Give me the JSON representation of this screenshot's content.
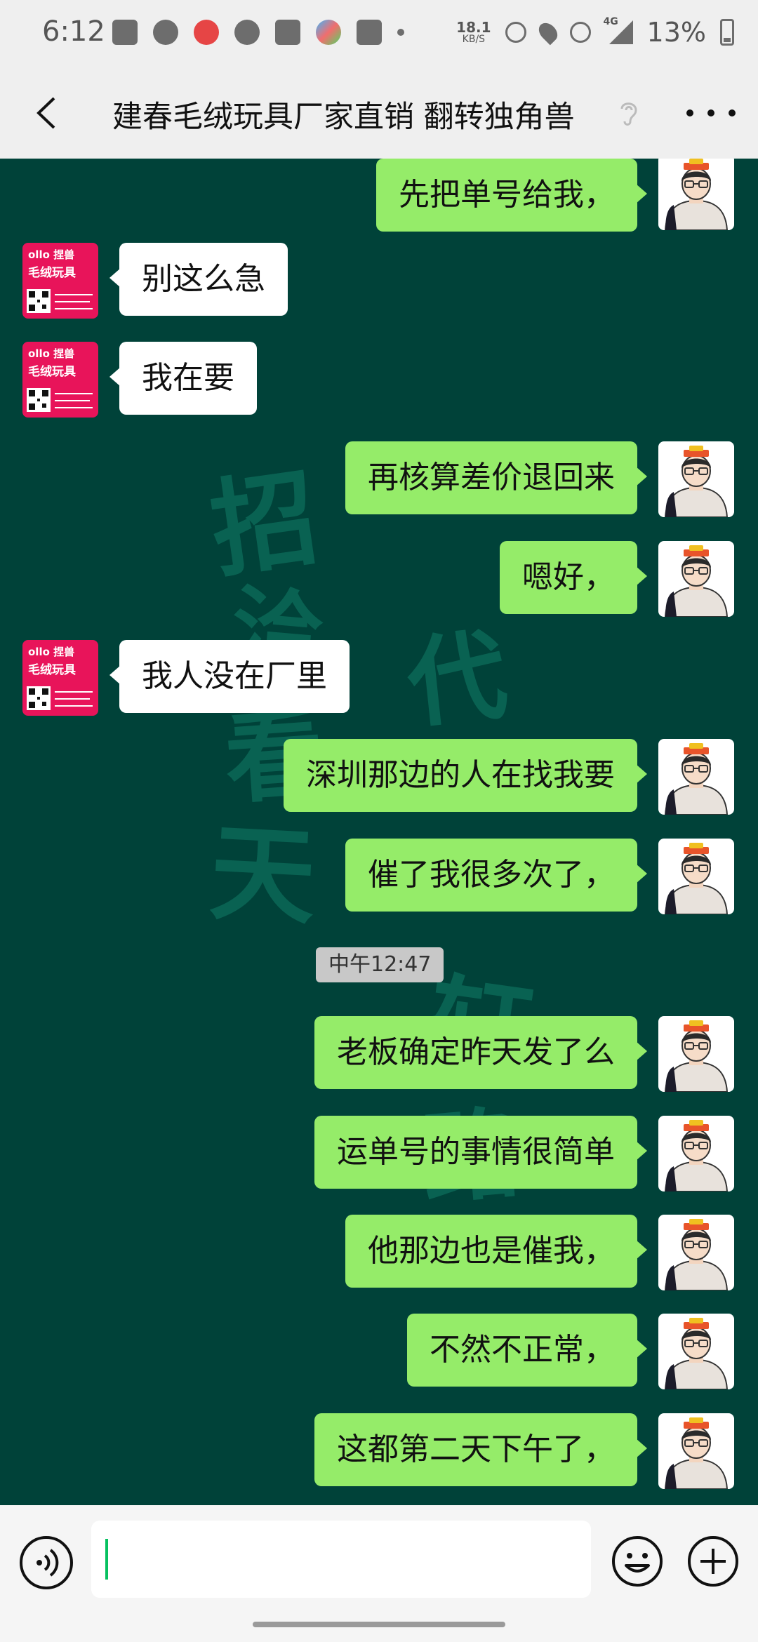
{
  "status_bar": {
    "time": "6:12",
    "net_speed_value": "18.1",
    "net_speed_unit": "KB/S",
    "network_type": "4G",
    "battery_percent": "13%",
    "icons": [
      "file-icon",
      "bird-icon",
      "video-app-icon",
      "facebook-icon",
      "mail-icon",
      "cloud-app-icon",
      "media-icon",
      "dot-icon",
      "alarm-icon",
      "location-icon",
      "hotspot-icon",
      "signal-icon",
      "battery-icon"
    ]
  },
  "header": {
    "title": "建春毛绒玩具厂家直销 翻转独角兽",
    "back_icon": "chevron-left-icon",
    "muted_icon": "ear-icon",
    "more_icon": "more-dots-icon"
  },
  "watermark": {
    "chars": [
      "招",
      "洽",
      "看",
      "天",
      "代",
      "轩",
      "路"
    ]
  },
  "messages": [
    {
      "side": "out",
      "text": "先把单号给我，"
    },
    {
      "side": "in",
      "text": "别这么急"
    },
    {
      "side": "in",
      "text": "我在要"
    },
    {
      "side": "out",
      "text": "再核算差价退回来"
    },
    {
      "side": "out",
      "text": "嗯好，"
    },
    {
      "side": "in",
      "text": "我人没在厂里"
    },
    {
      "side": "out",
      "text": "深圳那边的人在找我要"
    },
    {
      "side": "out",
      "text": "催了我很多次了，"
    },
    {
      "side": "out",
      "text": "老板确定昨天发了么"
    },
    {
      "side": "out",
      "text": "运单号的事情很简单"
    },
    {
      "side": "out",
      "text": "他那边也是催我，"
    },
    {
      "side": "out",
      "text": "不然不正常，"
    },
    {
      "side": "out",
      "text": "这都第二天下午了，"
    }
  ],
  "timestamp": "中午12:47",
  "contact_avatar_text": {
    "line1": "ollo 捏兽",
    "line2": "毛绒玩具"
  },
  "input_bar": {
    "value": "",
    "voice_icon": "voice-icon",
    "emoji_icon": "emoji-icon",
    "plus_icon": "plus-icon"
  },
  "colors": {
    "chat_bg": "#004239",
    "out_bubble": "#95ec69",
    "in_bubble": "#ffffff",
    "bars_bg": "#efefef"
  }
}
